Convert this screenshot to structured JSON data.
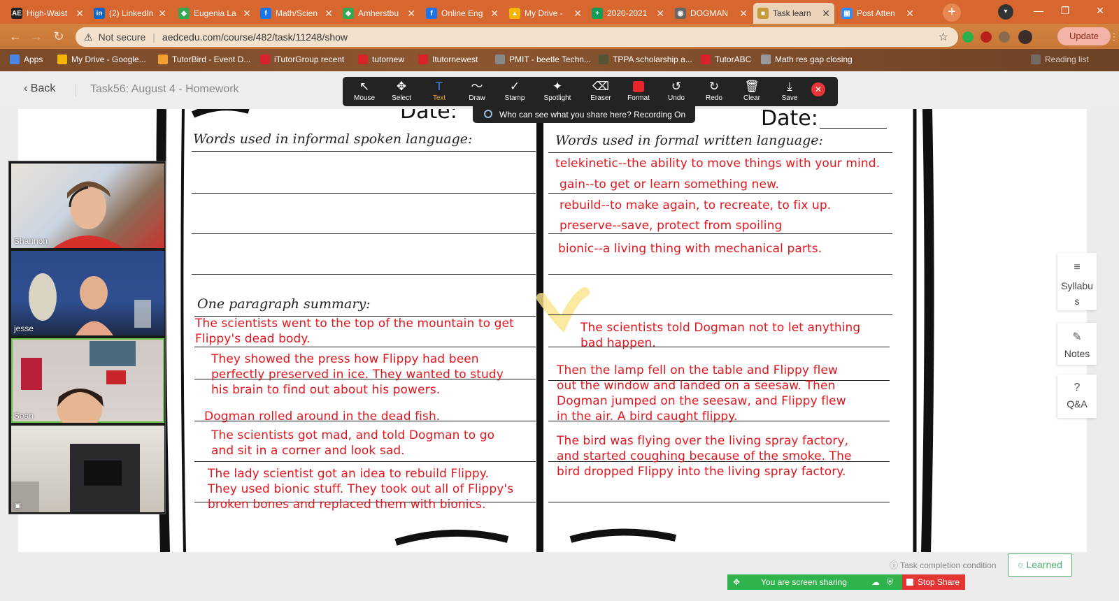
{
  "tabs": [
    {
      "title": "High-Waist",
      "icon": "AE",
      "color": "#222"
    },
    {
      "title": "(2) LinkedIn",
      "icon": "in",
      "color": "#0a66c2"
    },
    {
      "title": "Eugenia La",
      "icon": "◆",
      "color": "#34a853"
    },
    {
      "title": "Math/Scien",
      "icon": "f",
      "color": "#1c74e9"
    },
    {
      "title": "Amherstbu",
      "icon": "◆",
      "color": "#34a853"
    },
    {
      "title": "Online Eng",
      "icon": "f",
      "color": "#1c74e9"
    },
    {
      "title": "My Drive -",
      "icon": "▲",
      "color": "#f4b400"
    },
    {
      "title": "2020-2021",
      "icon": "+",
      "color": "#0f9d58"
    },
    {
      "title": "DOGMAN",
      "icon": "◉",
      "color": "#666"
    },
    {
      "title": "Task learn",
      "icon": "■",
      "color": "#c49a3a",
      "active": true
    },
    {
      "title": "Post Atten",
      "icon": "▣",
      "color": "#2d8cff"
    }
  ],
  "browser": {
    "security": "Not secure",
    "url": "aedcedu.com/course/482/task/11248/show",
    "update": "Update"
  },
  "bookmarks": [
    "Apps",
    "My Drive - Google...",
    "TutorBird - Event D...",
    "iTutorGroup recent",
    "tutornew",
    "Itutornewest",
    "PMIT - beetle Techn...",
    "TPPA scholarship a...",
    "TutorABC",
    "Math res gap closing",
    "Reading list"
  ],
  "header": {
    "back": "Back",
    "task_title": "Task56:  August 4 - Homework"
  },
  "annotate": {
    "tools": [
      "Mouse",
      "Select",
      "Text",
      "Draw",
      "Stamp",
      "Spotlight",
      "Eraser",
      "Format",
      "Undo",
      "Redo",
      "Clear",
      "Save"
    ],
    "recording": "Who can see what you share here? Recording On"
  },
  "worksheet": {
    "date_left": "Date:",
    "date_right": "Date:",
    "left_heading": "Words used in informal spoken language:",
    "right_heading": "Words used in formal written language:",
    "formal_words": [
      "telekinetic--the ability to move things with your mind.",
      "gain--to get or learn something new.",
      "rebuild--to make again, to recreate, to fix up.",
      "preserve--save, protect from spoiling",
      "bionic--a living thing with mechanical parts."
    ],
    "summary_heading": "One paragraph summary:",
    "summary_left": [
      "The scientists went to the top of the mountain to get\n  Flippy's dead body.",
      "They showed the press how Flippy had been\nperfectly preserved in ice.  They wanted to study\nhis brain to find out about his powers.",
      "Dogman rolled around in the dead fish.",
      "The scientists got mad, and told Dogman to go\nand sit in a corner and look sad.",
      "The lady scientist got an idea to rebuild Flippy.\nThey used bionic stuff. They took out all of Flippy's\nbroken bones and replaced them with bionics."
    ],
    "summary_right": [
      "The scientists told Dogman not to let anything\nbad happen.",
      "Then the lamp fell on the table and Flippy flew\nout the window and landed on a seesaw.  Then\nDogman jumped on the seesaw, and Flippy flew\nin the air.  A bird caught flippy.",
      "The bird was flying over the living spray factory,\nand started coughing because of the smoke. The\nbird dropped Flippy into the living spray factory."
    ]
  },
  "participants": [
    "Shannon",
    "jesse",
    "Sean",
    ""
  ],
  "side": {
    "syllabus": "Syllabu\ns",
    "notes": "Notes",
    "qa": "Q&A"
  },
  "footer": {
    "completion": "Task completion condition",
    "learned": "Learned",
    "sharing": "You are screen sharing",
    "stop": "Stop Share"
  }
}
